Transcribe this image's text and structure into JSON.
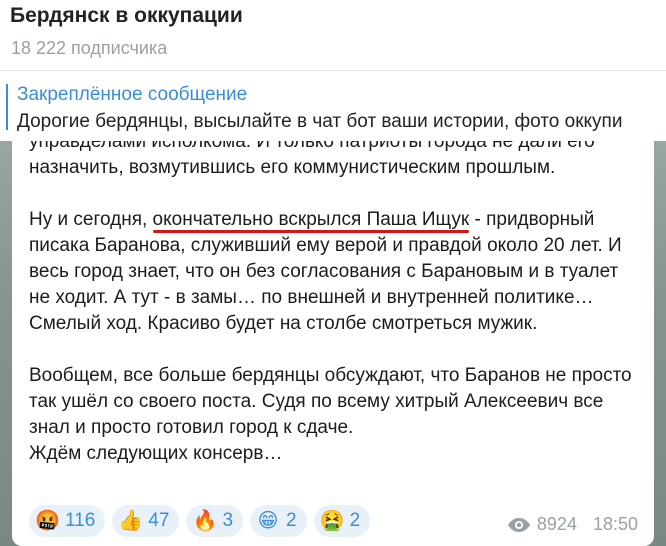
{
  "header": {
    "title": "Бердянск в оккупации",
    "subscribers": "18 222 подписчика"
  },
  "pinned": {
    "title": "Закреплённое сообщение",
    "text": "Дорогие бердянцы, высылайте в  чат бот ваши истории, фото оккупи"
  },
  "message": {
    "p1_line1": "управделами исполкома. И только патриоты города не дали его",
    "p1_line2": "назначить, возмутившись его коммунистическим прошлым.",
    "p2_before": "Ну и сегодня, ",
    "p2_highlight": "окончательно вскрылся Паша Ищук",
    "p2_after": " - придворный писака Баранова, служивший ему верой и правдой около 20 лет. И весь город знает, что он без согласования с Барановым и в туалет не ходит. А тут - в замы… по внешней и внутренней политике… Смелый ход. Красиво будет на столбе смотреться мужик.",
    "p3": "Вообщем, все больше бердянцы обсуждают, что Баранов не просто так ушёл со своего поста. Судя по всему хитрый Алексеевич все знал и просто готовил город к сдаче.",
    "p4": "Ждём следующих консерв…"
  },
  "reactions": [
    {
      "icon": "angry-face-icon",
      "glyph": "🤬",
      "count": "116"
    },
    {
      "icon": "thumbs-up-icon",
      "glyph": "👍",
      "count": "47"
    },
    {
      "icon": "fire-icon",
      "glyph": "🔥",
      "count": "3"
    },
    {
      "icon": "grinning-face-icon",
      "glyph": "😁",
      "count": "2"
    },
    {
      "icon": "vomiting-face-icon",
      "glyph": "🤮",
      "count": "2"
    }
  ],
  "meta": {
    "views": "8924",
    "time": "18:50"
  },
  "colors": {
    "accent": "#3a8dd8",
    "highlight_underline": "#d01818",
    "reaction_bg": "#e8f0f8"
  }
}
